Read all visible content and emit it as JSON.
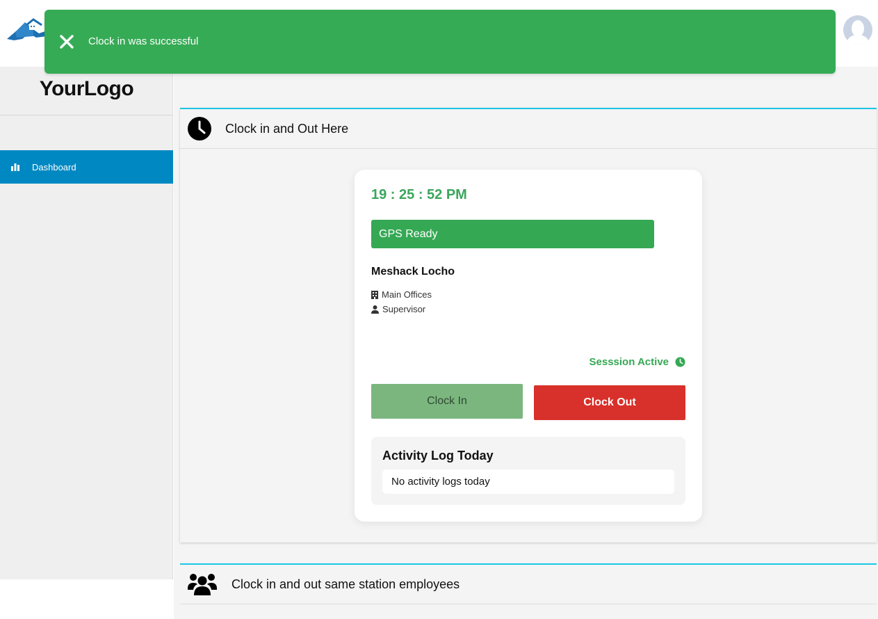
{
  "header": {
    "brand_logo_icon": "houses-logo-icon",
    "avatar_icon": "user-avatar-icon"
  },
  "sidebar": {
    "logo_text": "YourLogo",
    "items": [
      {
        "label": "Dashboard",
        "icon": "bar-chart-icon",
        "active": true
      }
    ]
  },
  "panels": {
    "clock": {
      "title": "Clock in and Out Here",
      "icon": "clock-icon"
    },
    "station": {
      "title": "Clock in and out same station employees",
      "icon": "users-group-icon"
    }
  },
  "card": {
    "time": "19 : 25 : 52 PM",
    "gps_status": "GPS Ready",
    "employee_name": "Meshack Locho",
    "office": "Main Offices",
    "role": "Supervisor",
    "session_status": "Sesssion Active",
    "clock_in_label": "Clock In",
    "clock_out_label": "Clock Out",
    "activity_log_title": "Activity Log Today",
    "activity_log_empty": "No activity logs today"
  },
  "toast": {
    "message": "Clock in was successful",
    "close_icon": "close-icon"
  },
  "colors": {
    "accent_blue": "#0088c2",
    "panel_border": "#1bc6e6",
    "success_green": "#36ab56",
    "danger_red": "#d8302a"
  }
}
